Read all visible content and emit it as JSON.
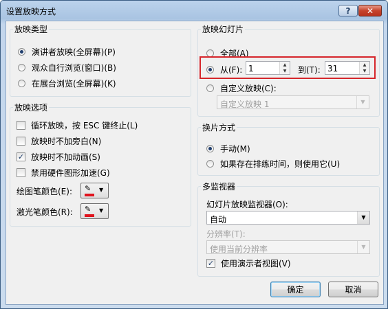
{
  "window": {
    "title": "设置放映方式",
    "help_label": "?",
    "close_label": "✕"
  },
  "show_type": {
    "legend": "放映类型",
    "options": [
      "演讲者放映(全屏幕)(P)",
      "观众自行浏览(窗口)(B)",
      "在展台浏览(全屏幕)(K)"
    ],
    "selected": 0
  },
  "show_options": {
    "legend": "放映选项",
    "checks": [
      {
        "label": "循环放映，按 ESC 键终止(L)",
        "checked": false
      },
      {
        "label": "放映时不加旁白(N)",
        "checked": false
      },
      {
        "label": "放映时不加动画(S)",
        "checked": true
      },
      {
        "label": "禁用硬件图形加速(G)",
        "checked": false
      }
    ],
    "pen_color_label": "绘图笔颜色(E):",
    "laser_color_label": "激光笔颜色(R):",
    "pen_color": "#e0141e",
    "laser_color": "#e0141e"
  },
  "slides": {
    "legend": "放映幻灯片",
    "all_label": "全部(A)",
    "from_label": "从(F):",
    "from_value": "1",
    "to_label": "到(T):",
    "to_value": "31",
    "custom_label": "自定义放映(C):",
    "custom_value": "自定义放映 1",
    "selected": "from"
  },
  "advance": {
    "legend": "换片方式",
    "options": [
      "手动(M)",
      "如果存在排练时间，则使用它(U)"
    ],
    "selected": 0
  },
  "monitors": {
    "legend": "多监视器",
    "monitor_label": "幻灯片放映监视器(O):",
    "monitor_value": "自动",
    "resolution_label": "分辨率(T):",
    "resolution_value": "使用当前分辨率",
    "presenter_view_label": "使用演示者视图(V)",
    "presenter_view_checked": true
  },
  "buttons": {
    "ok": "确定",
    "cancel": "取消"
  },
  "colors": {
    "highlight": "#d6262b",
    "title_bar": "#bcd3ec"
  }
}
